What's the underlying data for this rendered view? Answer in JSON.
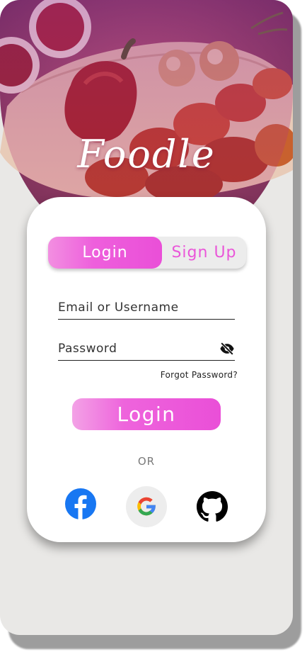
{
  "app": {
    "brand": "Foodle",
    "colors": {
      "accent": "#ea4fd8",
      "accent_light": "#f28fe1",
      "background": "#e9e8e6",
      "card": "#ffffff"
    }
  },
  "hero": {
    "image": "grilled-kebab-food-photo"
  },
  "auth_tabs": {
    "login_label": "Login",
    "signup_label": "Sign Up",
    "active": "Login"
  },
  "form": {
    "email_placeholder": "Email or Username",
    "email_value": "",
    "password_placeholder": "Password",
    "password_value": "",
    "password_toggle_icon": "eye-off-icon",
    "forgot_label": "Forgot Password?",
    "submit_label": "Login"
  },
  "divider": {
    "label": "OR"
  },
  "social": [
    {
      "name": "Facebook",
      "icon": "facebook-icon"
    },
    {
      "name": "Google",
      "icon": "google-icon"
    },
    {
      "name": "GitHub",
      "icon": "github-icon"
    }
  ]
}
